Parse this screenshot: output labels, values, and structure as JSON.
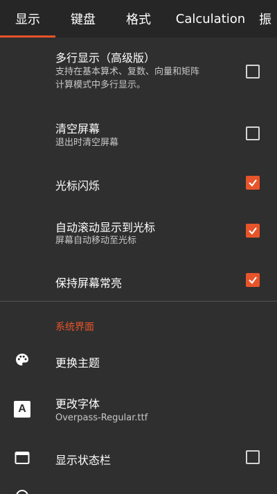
{
  "tabs": [
    {
      "label": "显示",
      "active": true
    },
    {
      "label": "键盘"
    },
    {
      "label": "格式"
    },
    {
      "label": "Calculation"
    },
    {
      "label": "振"
    }
  ],
  "settings": {
    "multiline": {
      "title": "多行显示（高级版）",
      "desc_line1": "支持在基本算术、复数、向量和矩阵",
      "desc_line2": "计算模式中多行显示。",
      "checked": false
    },
    "clear_screen": {
      "title": "清空屏幕",
      "desc": "退出时清空屏幕",
      "checked": false
    },
    "cursor_blink": {
      "title": "光标闪烁",
      "checked": true
    },
    "auto_scroll": {
      "title": "自动滚动显示到光标",
      "desc": "屏幕自动移动至光标",
      "checked": true
    },
    "keep_on": {
      "title": "保持屏幕常亮",
      "checked": true
    }
  },
  "section_header": "系统界面",
  "system": {
    "theme": {
      "title": "更换主题",
      "icon": "palette-icon"
    },
    "font": {
      "title": "更改字体",
      "desc": "Overpass-Regular.ttf",
      "icon": "font-a-icon",
      "icon_letter": "A"
    },
    "status_bar": {
      "title": "显示状态栏",
      "icon": "window-icon",
      "checked": false
    }
  },
  "colors": {
    "accent": "#e8542a",
    "background": "#2f2f2f",
    "tabbar": "#262626"
  }
}
